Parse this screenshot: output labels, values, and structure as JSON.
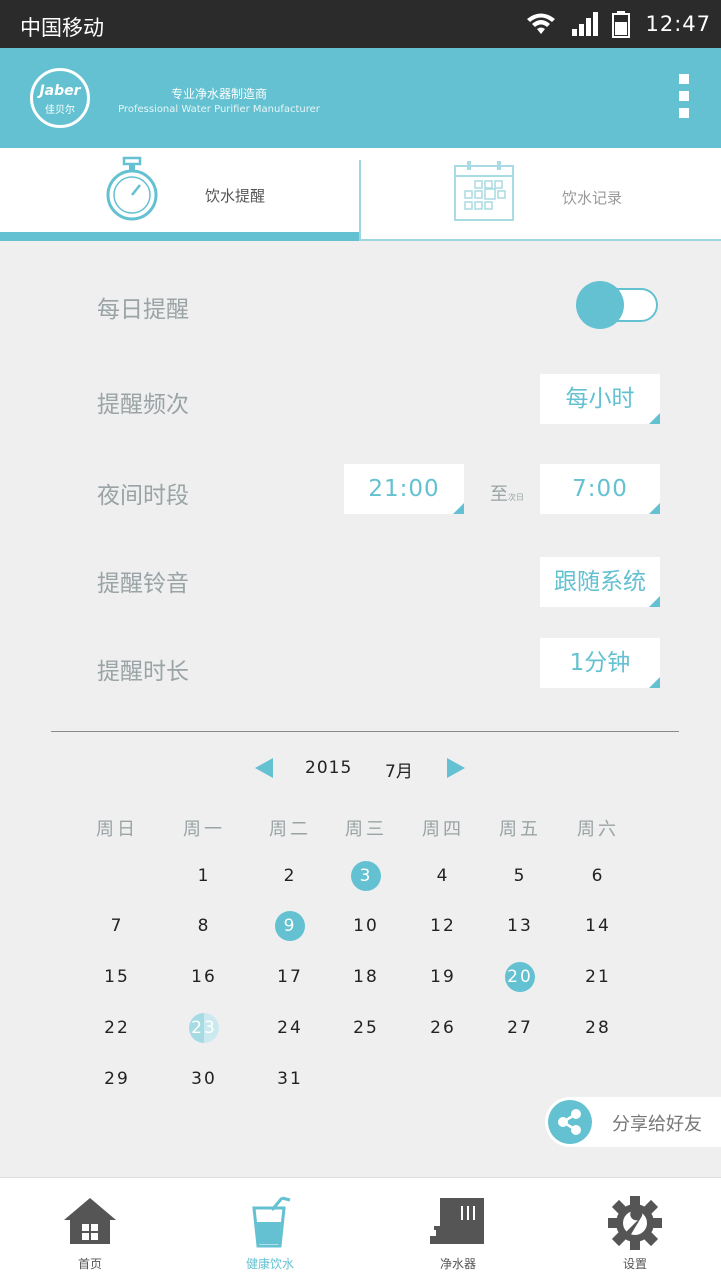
{
  "status_bar": {
    "carrier": "中国移动",
    "time": "12:47",
    "icons": [
      "wifi-icon",
      "signal-icon",
      "battery-icon"
    ]
  },
  "header": {
    "logo": {
      "brand_en": "Jaber",
      "brand_cn": "佳贝尔"
    },
    "tagline_cn": "专业净水器制造商",
    "tagline_en": "Professional Water Purifier Manufacturer",
    "menu_icon": "overflow-menu-icon"
  },
  "tabs": [
    {
      "label": "饮水提醒",
      "icon": "stopwatch-icon",
      "active": true
    },
    {
      "label": "饮水记录",
      "icon": "calendar-icon",
      "active": false
    }
  ],
  "settings": {
    "daily_reminder": {
      "label": "每日提醒",
      "on": true
    },
    "frequency": {
      "label": "提醒频次",
      "value": "每小时"
    },
    "night": {
      "label": "夜间时段",
      "start": "21:00",
      "to": "至",
      "next_day": "次日",
      "end": "7:00"
    },
    "ringtone": {
      "label": "提醒铃音",
      "value": "跟随系统"
    },
    "duration": {
      "label": "提醒时长",
      "value": "1分钟"
    }
  },
  "calendar": {
    "year": "2015",
    "month": "7月",
    "weekdays": [
      "周日",
      "周一",
      "周二",
      "周三",
      "周四",
      "周五",
      "周六"
    ],
    "weeks": [
      [
        "",
        "1",
        "2",
        "3",
        "4",
        "5",
        "6"
      ],
      [
        "7",
        "8",
        "9",
        "10",
        "12",
        "13",
        "14"
      ],
      [
        "15",
        "16",
        "17",
        "18",
        "19",
        "20",
        "21"
      ],
      [
        "22",
        "23",
        "24",
        "25",
        "26",
        "27",
        "28"
      ],
      [
        "29",
        "30",
        "31",
        "",
        "",
        "",
        ""
      ]
    ],
    "highlighted_days": [
      "3",
      "9",
      "20"
    ],
    "today": "23"
  },
  "share": {
    "label": "分享给好友",
    "icon": "share-icon"
  },
  "bottom_nav": [
    {
      "label": "首页",
      "icon": "home-icon",
      "active": false
    },
    {
      "label": "健康饮水",
      "icon": "water-glass-icon",
      "active": true
    },
    {
      "label": "净水器",
      "icon": "water-purifier-icon",
      "active": false
    },
    {
      "label": "设置",
      "icon": "gear-wrench-icon",
      "active": false
    }
  ],
  "colors": {
    "accent": "#63c1d1",
    "background": "#efefef",
    "label_gray": "#9aa3a5",
    "status_bar": "#2b2b2b"
  }
}
